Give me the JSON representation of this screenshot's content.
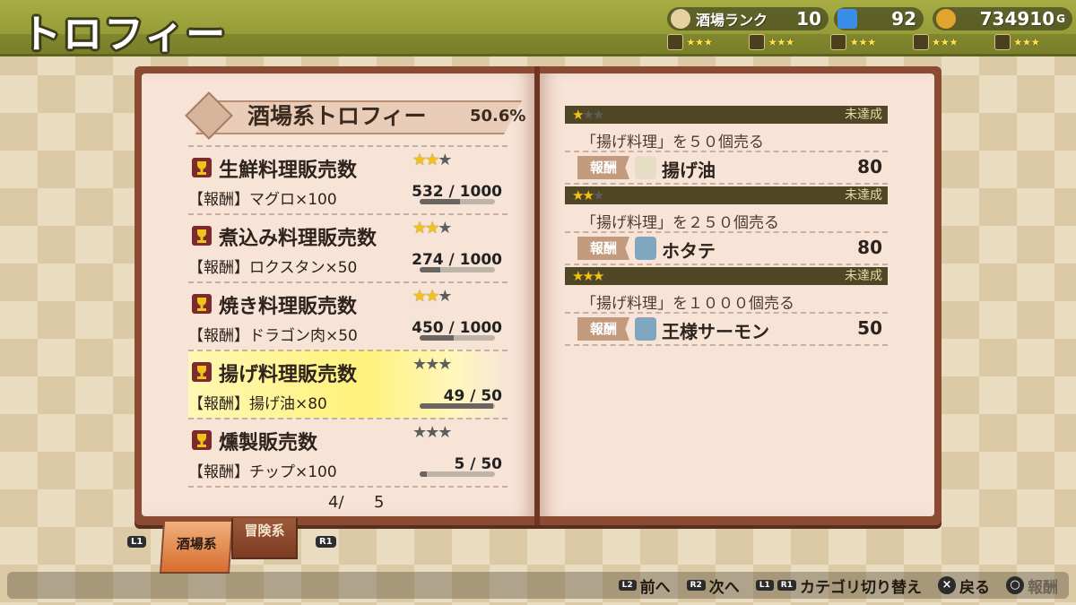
{
  "screen": {
    "title": "トロフィー"
  },
  "status": {
    "tavern_rank_label": "酒場ランク",
    "tavern_rank_value": "10",
    "gems": "92",
    "gold": "734910",
    "gold_unit": "G",
    "rank_categories": [
      {
        "icon": "shield-rank-icon",
        "stars": 3
      },
      {
        "icon": "book-rank-icon",
        "stars": 3
      },
      {
        "icon": "chest-rank-icon",
        "stars": 3
      },
      {
        "icon": "pot-rank-icon",
        "stars": 3
      },
      {
        "icon": "helmet-rank-icon",
        "stars": 3
      }
    ]
  },
  "category": {
    "title": "酒場系トロフィー",
    "percent": "50.6%"
  },
  "trophies": [
    {
      "name": "生鮮料理販売数",
      "reward": "【報酬】マグロ×100",
      "progress_text": "532 / 1000",
      "progress": 0.532,
      "stars_earned": 2
    },
    {
      "name": "煮込み料理販売数",
      "reward": "【報酬】ロクスタン×50",
      "progress_text": "274 / 1000",
      "progress": 0.274,
      "stars_earned": 2
    },
    {
      "name": "焼き料理販売数",
      "reward": "【報酬】ドラゴン肉×50",
      "progress_text": "450 / 1000",
      "progress": 0.45,
      "stars_earned": 2
    },
    {
      "name": "揚げ料理販売数",
      "reward": "【報酬】揚げ油×80",
      "progress_text": "49 / 50",
      "progress": 0.98,
      "stars_earned": 0,
      "selected": true
    },
    {
      "name": "燻製販売数",
      "reward": "【報酬】チップ×100",
      "progress_text": "5 / 50",
      "progress": 0.1,
      "stars_earned": 0
    }
  ],
  "pagination": {
    "current": "4/",
    "total": "5"
  },
  "achievements": [
    {
      "stars": 1,
      "status": "未達成",
      "description": "「揚げ料理」を５０個売る",
      "reward_label": "報酬",
      "reward_icon": "oil-bottle-icon",
      "reward_name": "揚げ油",
      "reward_qty": "80"
    },
    {
      "stars": 2,
      "status": "未達成",
      "description": "「揚げ料理」を２５０個売る",
      "reward_label": "報酬",
      "reward_icon": "fish-icon",
      "reward_name": "ホタテ",
      "reward_qty": "80"
    },
    {
      "stars": 3,
      "status": "未達成",
      "description": "「揚げ料理」を１０００個売る",
      "reward_label": "報酬",
      "reward_icon": "fish-icon",
      "reward_name": "王様サーモン",
      "reward_qty": "50"
    }
  ],
  "tabs": {
    "left_button": "L1",
    "right_button": "R1",
    "active": "酒場系",
    "inactive": "冒険系"
  },
  "help": {
    "prev": {
      "button": "L2",
      "label": "前へ"
    },
    "next": {
      "button": "R2",
      "label": "次へ"
    },
    "category": {
      "buttons": [
        "L1",
        "R1"
      ],
      "label": "カテゴリ切り替え"
    },
    "back": {
      "button": "×",
      "label": "戻る"
    },
    "reward": {
      "button": "○",
      "label": "報酬"
    }
  },
  "colors": {
    "star_on": "#f2c21a",
    "star_off": "#5d5d5d",
    "topbar": "#a8ae44",
    "book_cover": "#8b4a32"
  }
}
